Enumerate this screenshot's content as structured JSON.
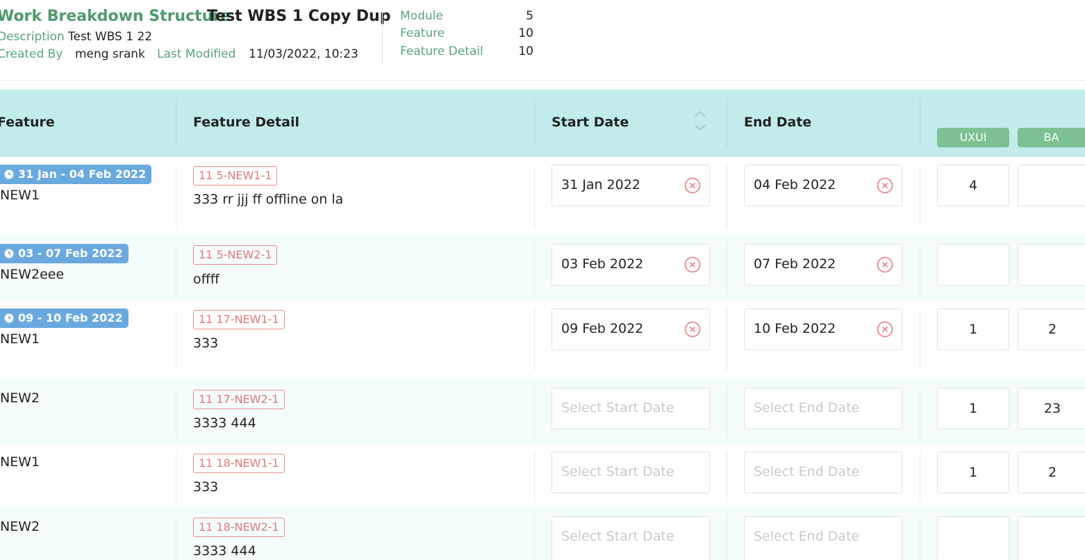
{
  "header": {
    "section_title": "Work Breakdown Structure",
    "wbs_name": "Test WBS 1 Copy Dup",
    "description_label": "Description",
    "description_value": "Test WBS 1 22",
    "created_by_label": "Created By",
    "created_by_value": "meng srank",
    "last_modified_label": "Last Modified",
    "last_modified_value": "11/03/2022, 10:23",
    "stats": [
      {
        "label": "Module",
        "value": "5"
      },
      {
        "label": "Feature",
        "value": "10"
      },
      {
        "label": "Feature Detail",
        "value": "10"
      }
    ]
  },
  "table": {
    "columns": {
      "feature": "Feature",
      "feature_detail": "Feature Detail",
      "start_date": "Start Date",
      "end_date": "End Date"
    },
    "resources": [
      "UXUI",
      "BA"
    ],
    "rows": [
      {
        "badge": "31 Jan - 04 Feb 2022",
        "feature": "NEW1",
        "code": "11 5-NEW1-1",
        "detail": "333 rr jjj ff offline on la",
        "start": "31 Jan 2022",
        "end": "04 Feb 2022",
        "uxui": "4",
        "ba": ""
      },
      {
        "badge": "03 - 07 Feb 2022",
        "feature": "NEW2eee",
        "code": "11 5-NEW2-1",
        "detail": "offff",
        "start": "03 Feb 2022",
        "end": "07 Feb 2022",
        "uxui": "",
        "ba": ""
      },
      {
        "badge": "09 - 10 Feb 2022",
        "feature": "NEW1",
        "code": "11 17-NEW1-1",
        "detail": "333",
        "start": "09 Feb 2022",
        "end": "10 Feb 2022",
        "uxui": "1",
        "ba": "2"
      },
      {
        "badge": "",
        "feature": "NEW2",
        "code": "11 17-NEW2-1",
        "detail": "3333 444",
        "start": "",
        "end": "",
        "uxui": "1",
        "ba": "23"
      },
      {
        "badge": "",
        "feature": "NEW1",
        "code": "11 18-NEW1-1",
        "detail": "333",
        "start": "",
        "end": "",
        "uxui": "1",
        "ba": "2"
      },
      {
        "badge": "",
        "feature": "NEW2",
        "code": "11 18-NEW2-1",
        "detail": "3333 444",
        "start": "",
        "end": "",
        "uxui": "",
        "ba": ""
      }
    ],
    "start_placeholder": "Select Start Date",
    "end_placeholder": "Select End Date"
  },
  "colors": {
    "accent_green": "#4e9a6e",
    "header_bg": "#c2ecec",
    "badge_blue": "#6aa9e0",
    "code_red": "#e07a7a",
    "resource_pill": "#7cc192"
  },
  "icons": [
    "clock-icon",
    "clear-icon",
    "sort-icon"
  ]
}
